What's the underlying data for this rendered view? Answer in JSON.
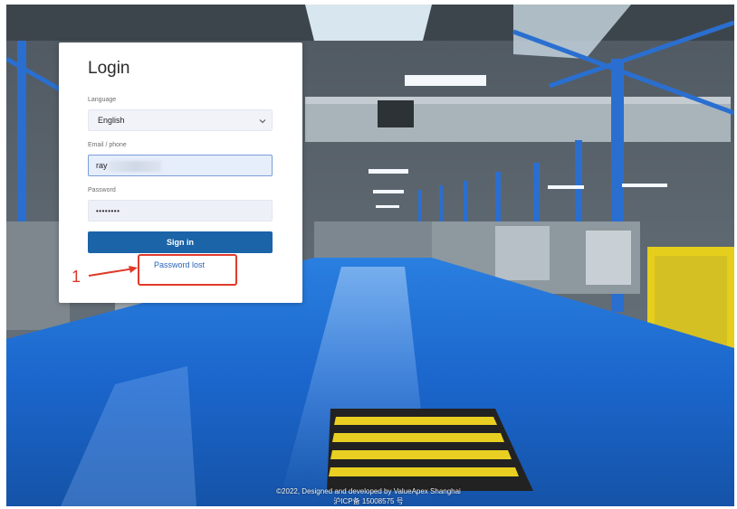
{
  "login": {
    "title": "Login",
    "language_label": "Language",
    "language_value": "English",
    "email_label": "Email / phone",
    "email_value": "ray",
    "password_label": "Password",
    "password_value": "••••••••",
    "signin_label": "Sign in",
    "password_lost_label": "Password lost"
  },
  "annotation": {
    "number": "1"
  },
  "footer": {
    "line1": "©2022, Designed and developed by ValueApex Shanghai",
    "line2": "沪ICP备 15008575 号"
  },
  "colors": {
    "primary_button": "#1b64a8",
    "link": "#2b63b6",
    "annotation": "#e03a2a",
    "floor": "#1e73d6"
  }
}
